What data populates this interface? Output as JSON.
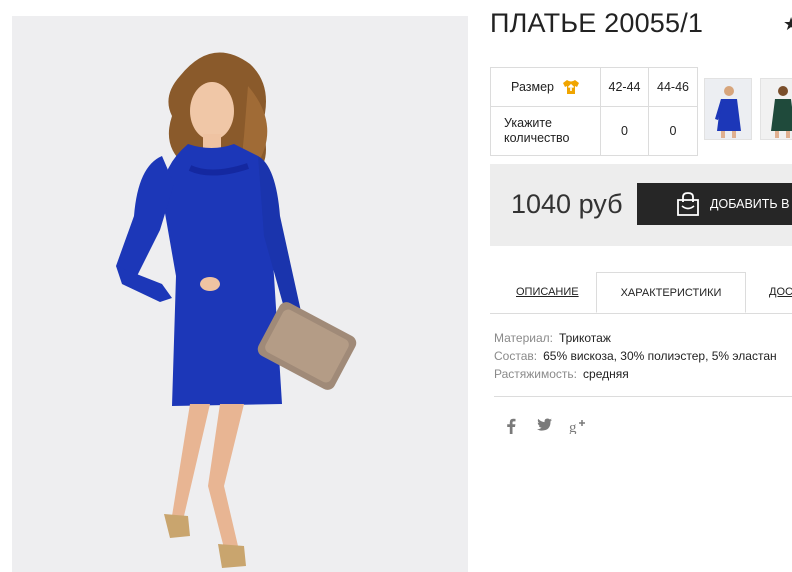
{
  "product": {
    "title": "ПЛАТЬЕ 20055/1",
    "price": "1040 руб"
  },
  "sizes": {
    "label": "Размер",
    "quantity_label_line1": "Укажите",
    "quantity_label_line2": "количество",
    "options": [
      {
        "size": "42-44",
        "qty": "0"
      },
      {
        "size": "44-46",
        "qty": "0"
      }
    ]
  },
  "buy": {
    "add_label": "ДОБАВИТЬ В ЗА"
  },
  "tabs": [
    {
      "label": "ОПИСАНИЕ"
    },
    {
      "label": "ХАРАКТЕРИСТИКИ"
    },
    {
      "label": "ДОС"
    }
  ],
  "specs": [
    {
      "label": "Материал:",
      "value": "Трикотаж"
    },
    {
      "label": "Состав:",
      "value": "65% вискоза, 30% полиэстер, 5% эластан"
    },
    {
      "label": "Растяжимость:",
      "value": "средняя"
    }
  ],
  "social": [
    "facebook-icon",
    "twitter-icon",
    "google-plus-icon"
  ],
  "colors": {
    "dress_blue": "#1c37b8",
    "dress_green": "#1f4a3b",
    "button_dark": "#262626",
    "size_icon": "#f0a500",
    "buybox_bg": "#ededed"
  }
}
